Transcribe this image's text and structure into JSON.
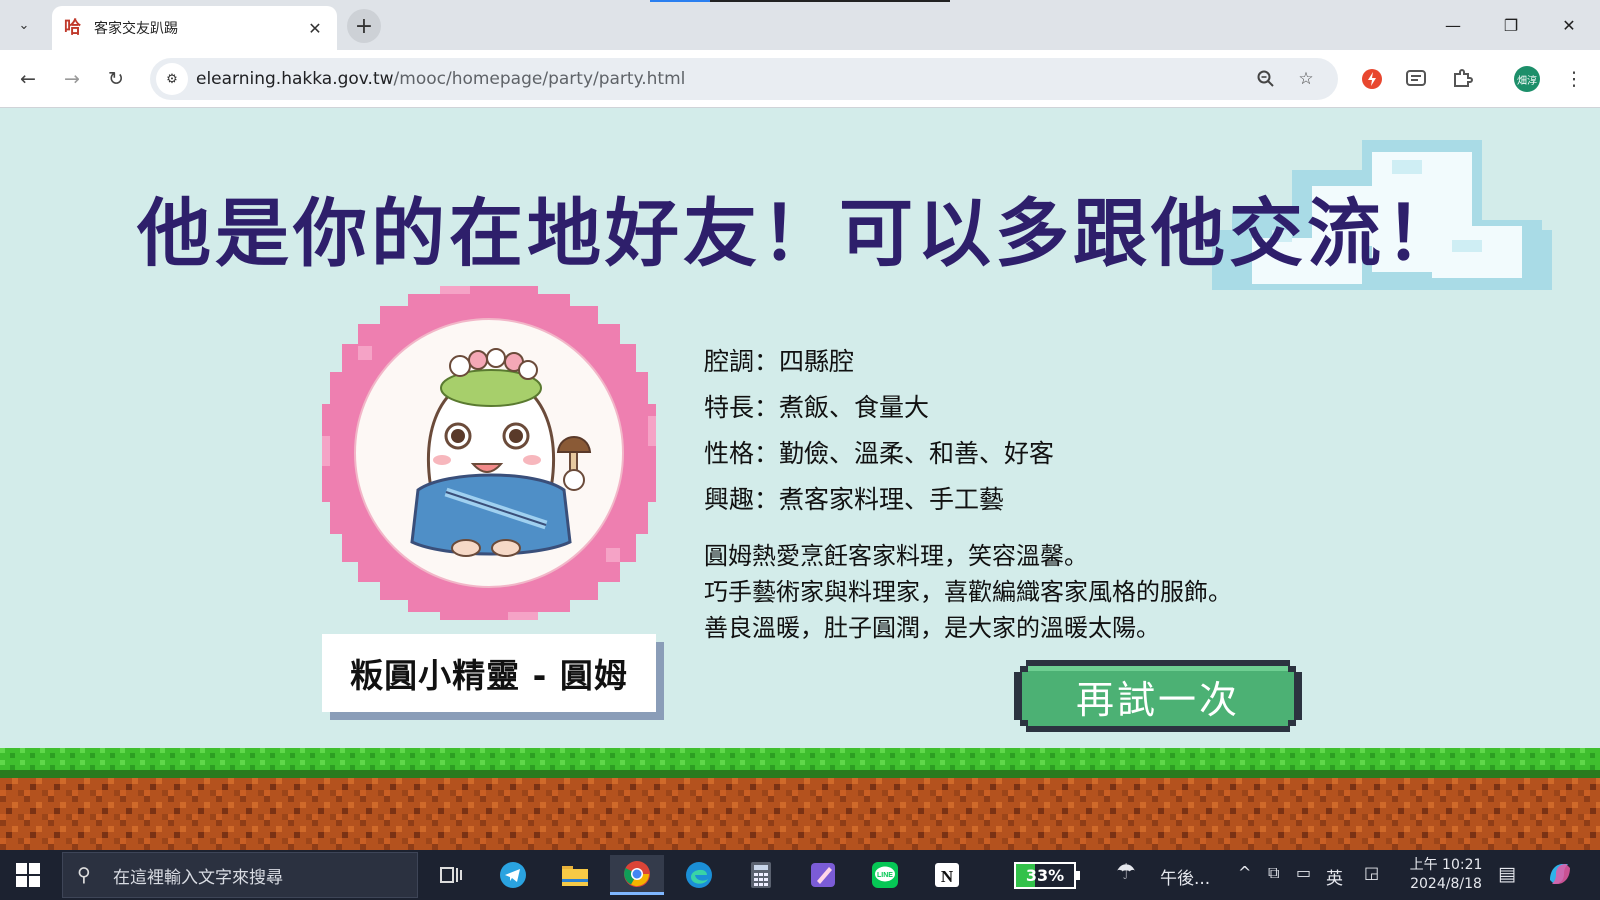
{
  "browser": {
    "tab_title": "客家交友趴踢",
    "tab_favicon_text": "哈",
    "url_host": "elearning.hakka.gov.tw",
    "url_path": "/mooc/homepage/party/party.html",
    "profile_initials": "畑淳"
  },
  "page": {
    "headline": "他是你的在地好友！可以多跟他交流！",
    "character_name": "粄圓小精靈 - 圓姆",
    "attributes": [
      "腔調：四縣腔",
      "特長：煮飯、食量大",
      "性格：勤儉、溫柔、和善、好客",
      "興趣：煮客家料理、手工藝"
    ],
    "description": [
      "圓姆熱愛烹飪客家料理，笑容溫馨。",
      "巧手藝術家與料理家，喜歡編織客家風格的服飾。",
      "善良溫暖，肚子圓潤，是大家的溫暖太陽。"
    ],
    "retry_label": "再試一次"
  },
  "taskbar": {
    "search_placeholder": "在這裡輸入文字來搜尋",
    "battery_level": 33,
    "battery_text": "33%",
    "weather_text": "午後...",
    "ime_label": "英",
    "clock_time": "上午 10:21",
    "clock_date": "2024/8/18"
  },
  "colors": {
    "page_bg": "#d3ecea",
    "headline": "#2e1f6b",
    "badge_pink": "#ee7fb0",
    "button_green": "#4cb174",
    "grass": "#3fbf2e",
    "soil": "#b4521e"
  },
  "icons": {
    "back": "arrow-left-icon",
    "forward": "arrow-right-icon",
    "reload": "reload-icon",
    "zoom": "zoom-icon",
    "bookmark": "star-icon",
    "extensions": "puzzle-icon",
    "menu": "kebab-icon"
  }
}
